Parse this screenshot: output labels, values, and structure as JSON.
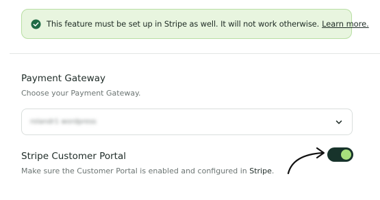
{
  "notice": {
    "icon": "check-circle-icon",
    "text": "This feature must be set up in Stripe as well. It will not work otherwise.",
    "link": "Learn more.",
    "colors": {
      "background": "#e8f5df",
      "border": "#b7dea2",
      "icon": "#1f6b45"
    }
  },
  "payment_gateway": {
    "title": "Payment Gateway",
    "description": "Choose your Payment Gateway.",
    "selected_value": "rolandr1 wordpress",
    "dropdown_icon": "chevron-down-icon"
  },
  "customer_portal": {
    "title": "Stripe Customer Portal",
    "description": "Make sure the Customer Portal is enabled and configured in",
    "link": "Stripe",
    "link_suffix": ".",
    "toggle_on": true,
    "toggle_colors": {
      "track": "#17332b",
      "knob": "#a8e07c"
    },
    "annotation_icon": "curved-arrow-icon"
  }
}
